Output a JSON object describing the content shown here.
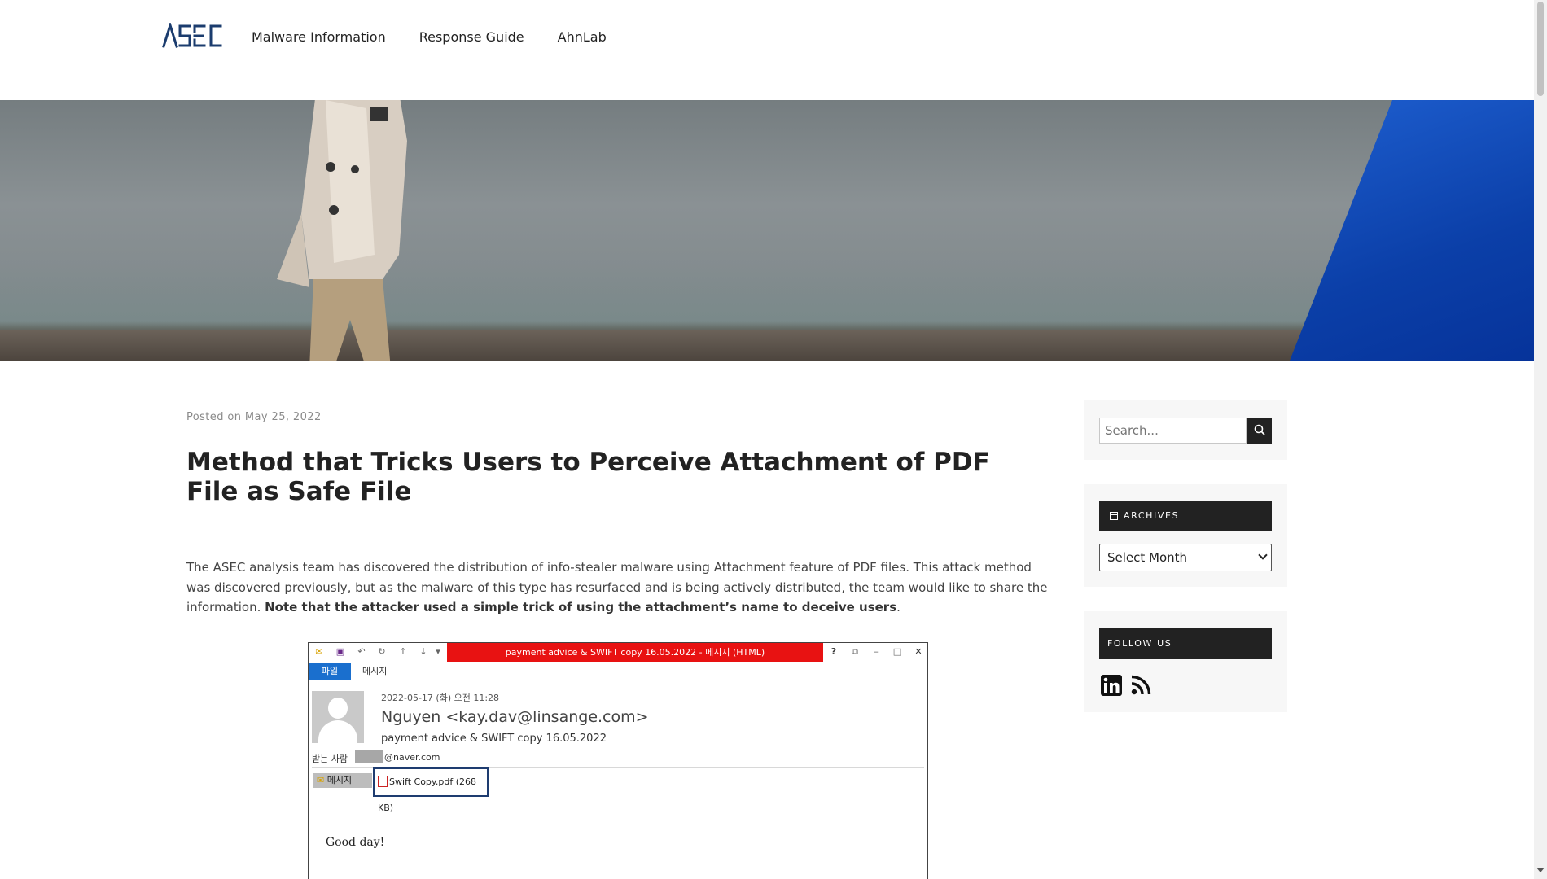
{
  "header": {
    "logo_text": "ASEC",
    "nav": [
      "Malware Information",
      "Response Guide",
      "AhnLab"
    ]
  },
  "post": {
    "meta_prefix": "Posted on",
    "date": "May 25, 2022",
    "title": "Method that Tricks Users to Perceive Attachment of PDF File as Safe File",
    "body_intro": "The ASEC analysis team has discovered the distribution of info-stealer malware using Attachment feature of PDF files. This attack method was discovered previously, but as the malware of this type has resurfaced and is being actively distributed, the team would like to share the information.",
    "body_bold": "Note that the attacker used a simple trick of using the attachment’s name to deceive users",
    "body_end": "."
  },
  "email_screenshot": {
    "window_title": "payment advice & SWIFT copy 16.05.2022 -  메시지 (HTML)",
    "tab_file": "파일",
    "tab_message": "메시지",
    "date": "2022-05-17 (화) 오전 11:28",
    "sender": "Nguyen <kay.dav@linsange.com>",
    "subject": "payment advice & SWIFT copy 16.05.2022",
    "to_label": "받는 사람",
    "to_address": "@naver.com",
    "message_tab": "메시지",
    "attachment": "Swift Copy.pdf (268 KB)",
    "greeting": "Good day!"
  },
  "sidebar": {
    "search_placeholder": "Search...",
    "archives_title": "ARCHIVES",
    "archives_select": "Select Month",
    "follow_title": "FOLLOW US"
  },
  "colors": {
    "accent_dark": "#222222",
    "logo_blue": "#1b3c6e",
    "email_title_red": "#e81212",
    "email_tab_blue": "#1a6fce"
  }
}
